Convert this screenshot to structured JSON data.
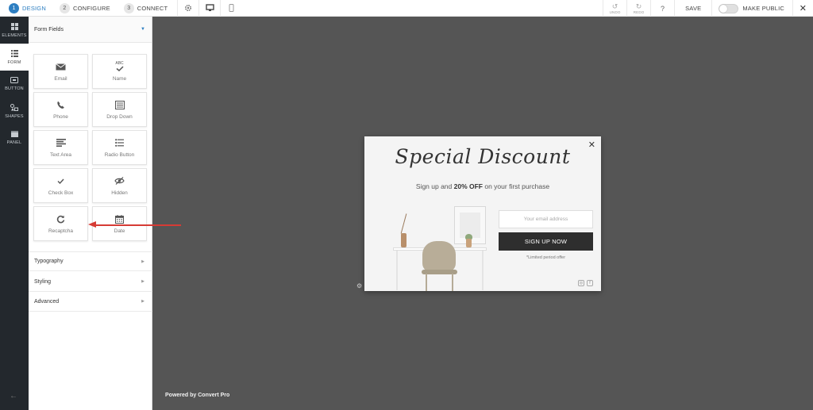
{
  "topbar": {
    "steps": [
      {
        "num": "1",
        "label": "DESIGN"
      },
      {
        "num": "2",
        "label": "CONFIGURE"
      },
      {
        "num": "3",
        "label": "CONNECT"
      }
    ],
    "icons": [
      "gear-icon",
      "desktop-icon",
      "mobile-icon"
    ],
    "undo_label": "UNDO",
    "redo_label": "REDO",
    "help_label": "?",
    "save_label": "SAVE",
    "make_public_label": "MAKE PUBLIC",
    "make_public_enabled": false,
    "close_label": "✕"
  },
  "rail": {
    "tabs": [
      {
        "label": "ELEMENTS",
        "icon": "grid-icon"
      },
      {
        "label": "FORM",
        "icon": "list-icon"
      },
      {
        "label": "BUTTON",
        "icon": "button-icon"
      },
      {
        "label": "SHAPES",
        "icon": "shapes-icon"
      },
      {
        "label": "PANEL",
        "icon": "panel-icon"
      }
    ],
    "active_tab": "FORM",
    "back_icon": "arrow-left-icon"
  },
  "panel": {
    "header": "Form Fields",
    "fields": [
      {
        "label": "Email",
        "icon": "envelope-icon"
      },
      {
        "label": "Name",
        "icon": "abc-check-icon",
        "icon_text": "ABC"
      },
      {
        "label": "Phone",
        "icon": "phone-icon"
      },
      {
        "label": "Drop Down",
        "icon": "dropdown-list-icon"
      },
      {
        "label": "Text Area",
        "icon": "textarea-icon"
      },
      {
        "label": "Radio Button",
        "icon": "radio-list-icon"
      },
      {
        "label": "Check Box",
        "icon": "checkmark-icon"
      },
      {
        "label": "Hidden",
        "icon": "eye-slash-icon"
      },
      {
        "label": "Recaptcha",
        "icon": "refresh-icon"
      },
      {
        "label": "Date",
        "icon": "calendar-icon"
      }
    ],
    "sections": [
      "Typography",
      "Styling",
      "Advanced"
    ]
  },
  "canvas": {
    "footer": "Powered by Convert Pro",
    "background": "#555555",
    "annotation_color": "#d63b35"
  },
  "popup": {
    "title": "Special Discount",
    "subtitle_pre": "Sign up and ",
    "subtitle_bold": "20% OFF",
    "subtitle_post": " on your first purchase",
    "email_placeholder": "Your email address",
    "button_label": "SIGN UP NOW",
    "limited_note": "*Limited period offer",
    "close_label": "✕",
    "social_icons": [
      "instagram-icon",
      "facebook-icon"
    ]
  },
  "colors": {
    "accent": "#2e7fc2",
    "rail_bg": "#23282d",
    "button_dark": "#2e2e2e"
  }
}
